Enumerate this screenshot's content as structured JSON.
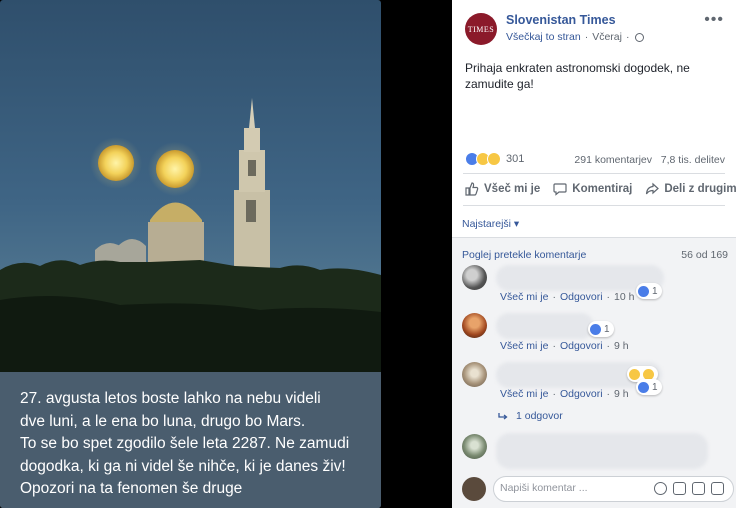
{
  "photo": {
    "caption_lines": [
      "27. avgusta letos boste lahko na nebu videli",
      "dve luni, a le ena bo luna, drugo bo Mars.",
      "To se bo spet zgodilo šele leta 2287. Ne zamudi",
      "dogodka, ki ga ni videl še nihče, ki je danes živ!",
      "Opozori na ta fenomen še druge"
    ]
  },
  "post": {
    "logo_text": "TIMES",
    "page_name": "Slovenistan Times",
    "follow_label": "Všečkaj to stran",
    "separator": "·",
    "time": "Včeraj",
    "more": "•••",
    "text": "Prihaja enkraten astronomski dogodek, ne zamudite ga!",
    "reaction_count": "301",
    "comments_count": "291 komentarjev",
    "shares_count": "7,8 tis. delitev",
    "actions": {
      "like": "Všeč mi je",
      "comment": "Komentiraj",
      "share": "Deli z drugimi"
    },
    "sort_label": "Najstarejši ▾"
  },
  "comments": {
    "prev_link": "Poglej pretekle komentarje",
    "page_count": "56 od 169",
    "items": [
      {
        "like": "Všeč mi je",
        "reply": "Odgovori",
        "time": "10 h",
        "reactions": "1"
      },
      {
        "like": "Všeč mi je",
        "reply": "Odgovori",
        "time": "9 h",
        "reactions": "1"
      },
      {
        "like": "Všeč mi je",
        "reply": "Odgovori",
        "time": "9 h",
        "reactions": "1"
      }
    ],
    "replies_label": "1 odgovor",
    "composer_placeholder": "Napiši komentar ..."
  },
  "colors": {
    "link": "#365899",
    "meta": "#606770",
    "like_blue": "#4a7de8",
    "brand": "#8b1a2a"
  }
}
